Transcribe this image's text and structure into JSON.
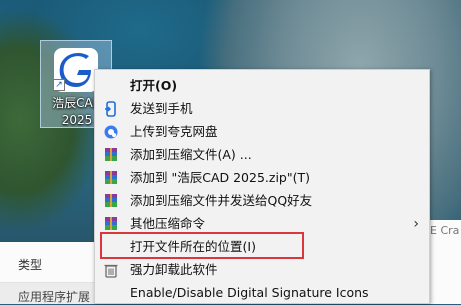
{
  "desktop": {
    "icon": {
      "label_line1": "浩辰CAD",
      "label_line2": "2025",
      "shortcut_glyph": "↗"
    }
  },
  "explorer": {
    "column_type": "类型",
    "row_type": "应用程序扩展",
    "right_peek": "E Cra"
  },
  "context_menu": {
    "items": [
      {
        "label": "打开(O)",
        "icon": "none",
        "bold": true
      },
      {
        "label": "发送到手机",
        "icon": "phone-send-icon"
      },
      {
        "label": "上传到夸克网盘",
        "icon": "cloud-upload-icon"
      },
      {
        "label": "添加到压缩文件(A) ...",
        "icon": "winrar-archive-icon"
      },
      {
        "label": "添加到 \"浩辰CAD 2025.zip\"(T)",
        "icon": "winrar-archive-icon"
      },
      {
        "label": "添加到压缩文件并发送给QQ好友",
        "icon": "winrar-archive-icon"
      },
      {
        "label": "其他压缩命令",
        "icon": "winrar-archive-icon",
        "arrow": "›"
      },
      {
        "label": "打开文件所在的位置(I)",
        "icon": "none"
      },
      {
        "label": "强力卸载此软件",
        "icon": "trash-icon"
      },
      {
        "label": "Enable/Disable Digital Signature Icons",
        "icon": "none"
      }
    ]
  },
  "colors": {
    "menu_bg": "#f2f2f2",
    "highlight_border": "#d9363e",
    "logo_blue": "#1a5cc8"
  }
}
